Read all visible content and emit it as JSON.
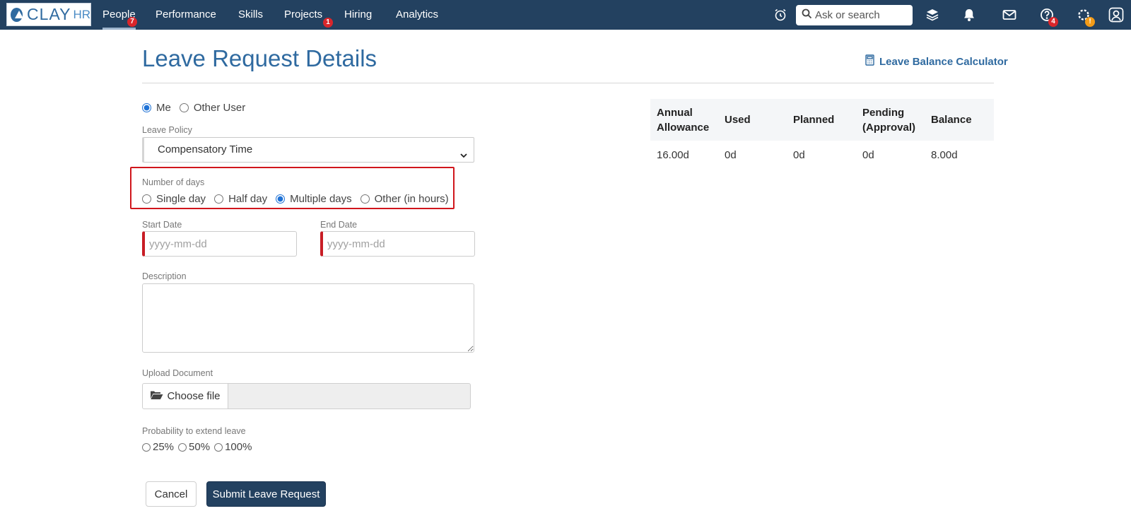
{
  "nav": {
    "logo_text": "CLAY",
    "logo_suffix": "HR",
    "items": [
      {
        "label": "People",
        "badge": "7",
        "active": true
      },
      {
        "label": "Performance"
      },
      {
        "label": "Skills"
      },
      {
        "label": "Projects",
        "badge": "1"
      },
      {
        "label": "Hiring"
      },
      {
        "label": "Analytics"
      }
    ],
    "search_placeholder": "Ask or search",
    "icons": [
      "alarm-clock-icon",
      "layers-icon",
      "bell-icon",
      "mail-icon",
      "help-icon",
      "gear-icon",
      "user-icon"
    ],
    "help_badge": "4",
    "gear_badge": "!"
  },
  "page": {
    "title": "Leave Request Details",
    "calculator_link": "Leave Balance Calculator"
  },
  "form": {
    "user_options": [
      "Me",
      "Other User"
    ],
    "user_selected": "Me",
    "leave_policy_label": "Leave Policy",
    "leave_policy_value": "Compensatory Time",
    "days_label": "Number of days",
    "days_options": [
      "Single day",
      "Half day",
      "Multiple days",
      "Other (in hours)"
    ],
    "days_selected": "Multiple days",
    "start_date_label": "Start Date",
    "end_date_label": "End Date",
    "date_placeholder": "yyyy-mm-dd",
    "description_label": "Description",
    "upload_label": "Upload Document",
    "choose_file": "Choose file",
    "probability_label": "Probability to extend leave",
    "probability_options": [
      "25%",
      "50%",
      "100%"
    ],
    "cancel_label": "Cancel",
    "submit_label": "Submit Leave Request"
  },
  "balance": {
    "headers": [
      "Annual Allowance",
      "Used",
      "Planned",
      "Pending (Approval)",
      "Balance"
    ],
    "values": [
      "16.00d",
      "0d",
      "0d",
      "0d",
      "8.00d"
    ]
  },
  "colors": {
    "nav_bg": "#234160",
    "accent_blue": "#2f6aa0",
    "badge_red": "#d9262b",
    "badge_orange": "#f29b18",
    "required_red": "#c81d25",
    "highlight_red": "#d0161c"
  }
}
